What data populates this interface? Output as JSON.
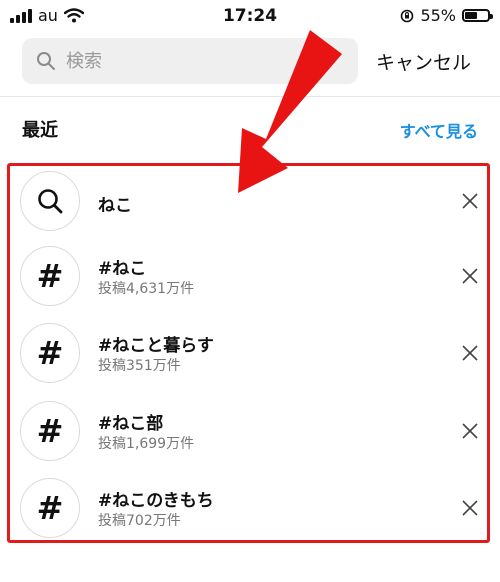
{
  "status": {
    "carrier": "au",
    "time": "17:24",
    "battery_percent_label": "55%",
    "battery_level": 0.55
  },
  "search": {
    "placeholder": "検索",
    "cancel_label": "キャンセル"
  },
  "recent": {
    "title": "最近",
    "see_all": "すべて見る",
    "items": [
      {
        "type": "search-term",
        "icon": "search-icon",
        "title": "ねこ",
        "sub": ""
      },
      {
        "type": "hashtag",
        "icon": "hashtag-icon",
        "title": "#ねこ",
        "sub": "投稿4,631万件"
      },
      {
        "type": "hashtag",
        "icon": "hashtag-icon",
        "title": "#ねこと暮らす",
        "sub": "投稿351万件"
      },
      {
        "type": "hashtag",
        "icon": "hashtag-icon",
        "title": "#ねこ部",
        "sub": "投稿1,699万件"
      },
      {
        "type": "hashtag",
        "icon": "hashtag-icon",
        "title": "#ねこのきもち",
        "sub": "投稿702万件"
      }
    ]
  },
  "colors": {
    "accent": "#1a8fe3",
    "highlight": "#e11b1b"
  }
}
